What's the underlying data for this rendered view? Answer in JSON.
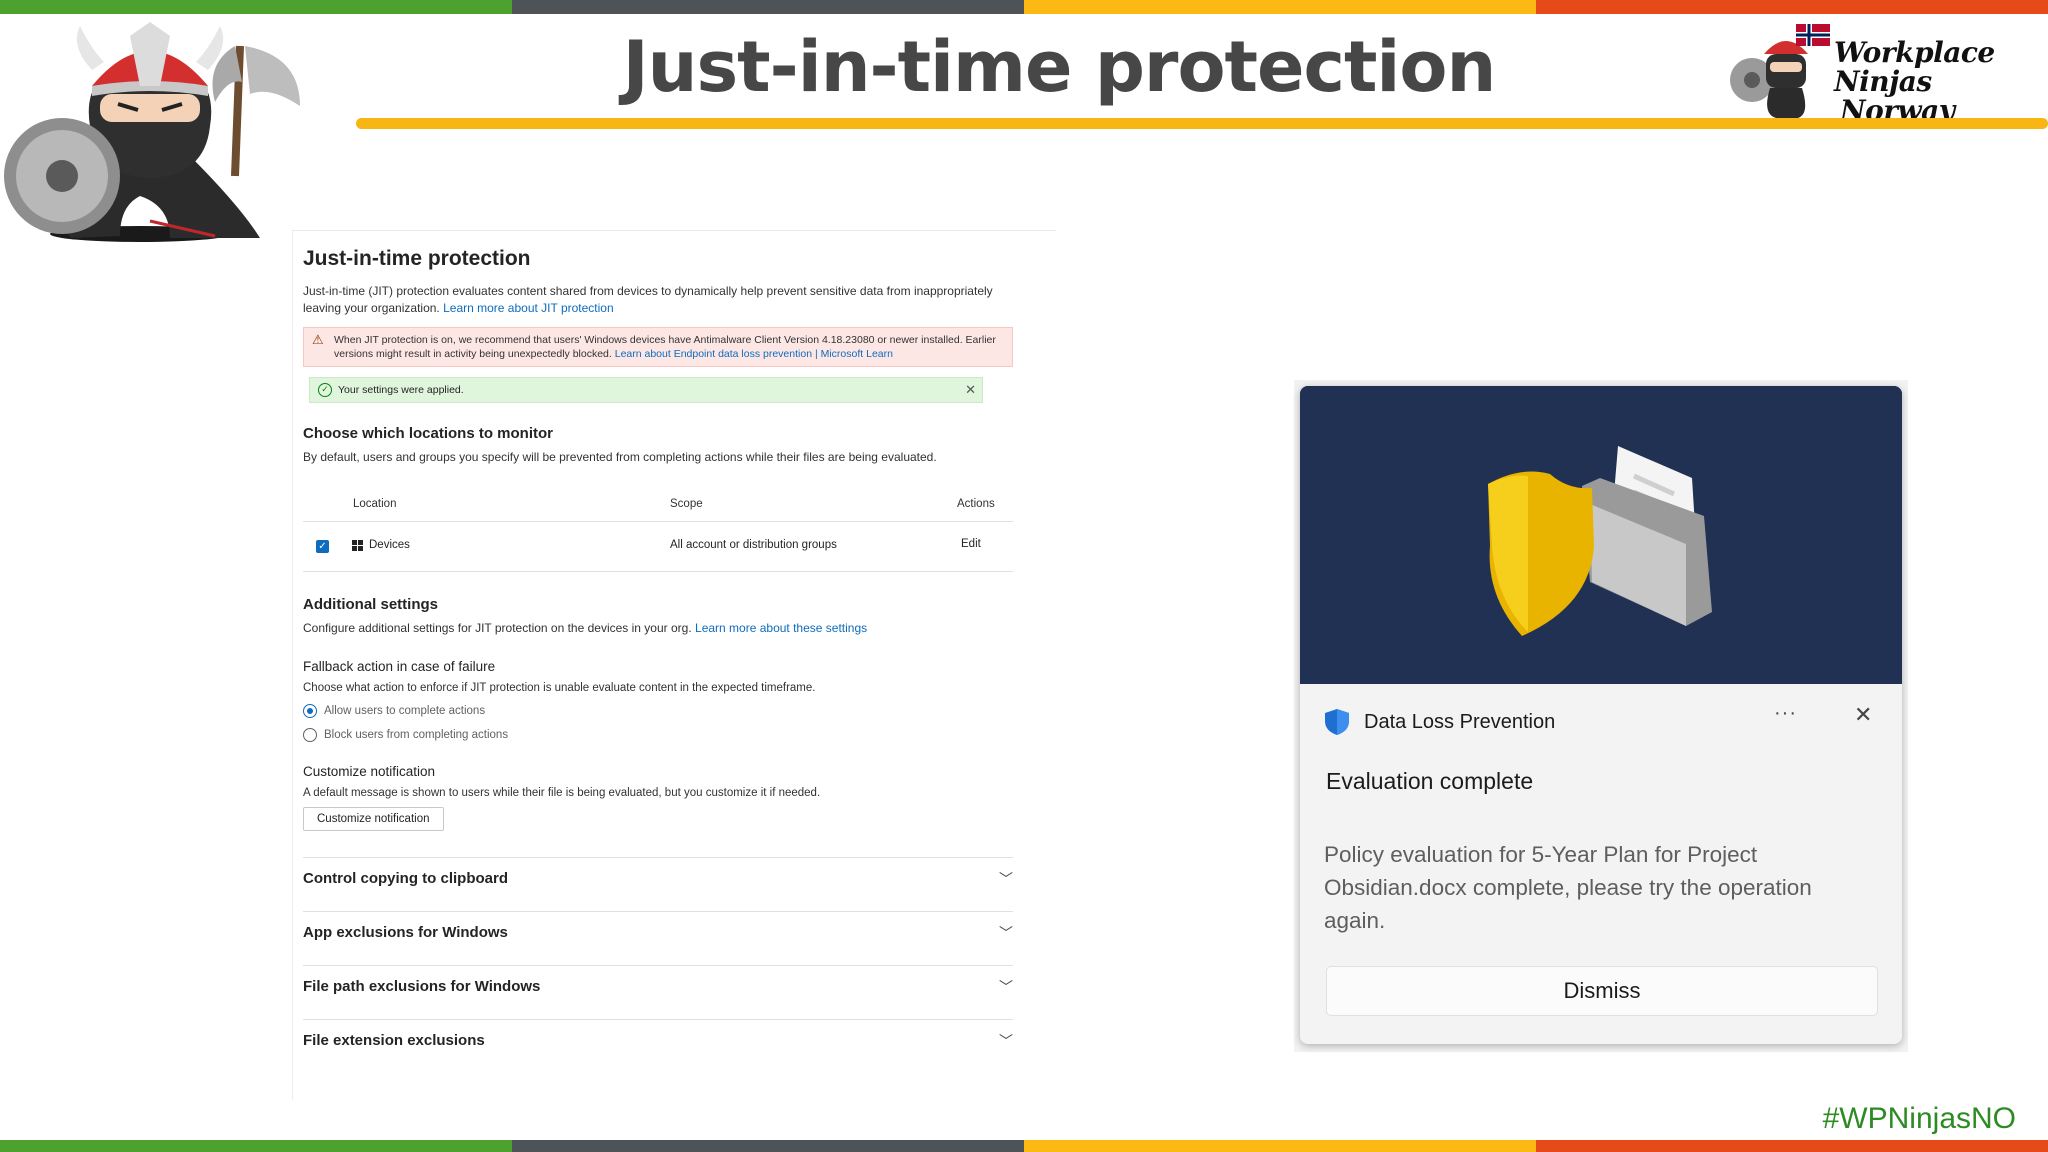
{
  "slide": {
    "title": "Just-in-time protection",
    "hashtag": "#WPNinjasNO",
    "brand": {
      "line1": "Workplace Ninjas",
      "line2": "Norway"
    },
    "colors": {
      "green": "#4ca12f",
      "gray": "#4e5357",
      "yellow": "#fdb913",
      "orange": "#e64a19",
      "rule": "#f7b614"
    }
  },
  "panel": {
    "title": "Just-in-time protection",
    "description": "Just-in-time (JIT) protection evaluates content shared from devices to dynamically help prevent sensitive data from inappropriately leaving your organization.",
    "description_link": "Learn more about JIT protection",
    "warning": {
      "text": "When JIT protection is on, we recommend that users' Windows devices have Antimalware Client Version 4.18.23080 or newer installed. Earlier versions might result in activity being unexpectedly blocked.",
      "link": "Learn about Endpoint data loss prevention | Microsoft Learn"
    },
    "success": "Your settings were applied.",
    "locations": {
      "title": "Choose which locations to monitor",
      "description": "By default, users and groups you specify will be prevented from completing actions while their files are being evaluated.",
      "columns": {
        "location": "Location",
        "scope": "Scope",
        "actions": "Actions"
      },
      "row": {
        "location": "Devices",
        "scope": "All account or distribution groups",
        "action": "Edit"
      }
    },
    "additional": {
      "title": "Additional settings",
      "description": "Configure additional settings for JIT protection on the devices in your org.",
      "link": "Learn more about these settings"
    },
    "fallback": {
      "title": "Fallback action in case of failure",
      "description": "Choose what action to enforce if JIT protection is unable evaluate content in the expected timeframe.",
      "option1": "Allow users to complete actions",
      "option2": "Block users from completing actions"
    },
    "customize": {
      "title": "Customize notification",
      "description": "A default message is shown to users while their file is being evaluated, but you customize it if needed.",
      "button": "Customize notification"
    },
    "accordions": [
      "Control copying to clipboard",
      "App exclusions for Windows",
      "File path exclusions for Windows",
      "File extension exclusions"
    ]
  },
  "toast": {
    "app": "Data Loss Prevention",
    "more": "···",
    "close": "✕",
    "subject": "Evaluation complete",
    "body": "Policy evaluation for 5-Year Plan for Project Obsidian.docx complete, please try the operation again.",
    "dismiss": "Dismiss"
  }
}
